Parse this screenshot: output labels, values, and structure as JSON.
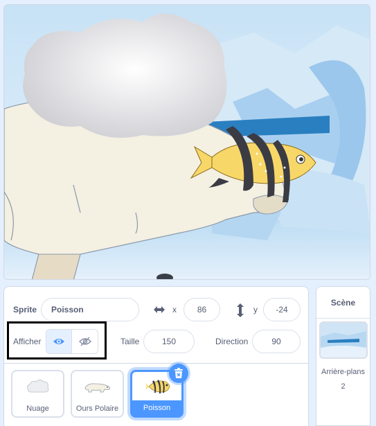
{
  "sprite_info": {
    "sprite_label": "Sprite",
    "sprite_name": "Poisson",
    "x_label": "x",
    "x_value": "86",
    "y_label": "y",
    "y_value": "-24",
    "show_label": "Afficher",
    "show_state": "visible",
    "size_label": "Taille",
    "size_value": "150",
    "direction_label": "Direction",
    "direction_value": "90"
  },
  "sprites": [
    {
      "name": "Nuage",
      "icon": "cloud-icon",
      "selected": false
    },
    {
      "name": "Ours Polaire",
      "icon": "polar-bear-icon",
      "selected": false
    },
    {
      "name": "Poisson",
      "icon": "fish-icon",
      "selected": true
    }
  ],
  "stage_panel": {
    "title": "Scène",
    "backdrops_label": "Arrière-plans",
    "backdrops_count": "2"
  },
  "colors": {
    "accent": "#4c97ff",
    "text": "#575e75",
    "background": "#e5f0ff"
  }
}
